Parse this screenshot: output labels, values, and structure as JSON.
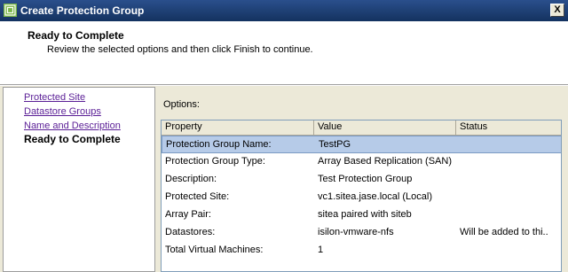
{
  "window": {
    "title": "Create Protection Group",
    "close_label": "X"
  },
  "header": {
    "title": "Ready to Complete",
    "subtitle": "Review the selected options and then click Finish to continue."
  },
  "nav": {
    "items": [
      {
        "label": "Protected Site"
      },
      {
        "label": "Datastore Groups"
      },
      {
        "label": "Name and Description"
      },
      {
        "label": "Ready to Complete"
      }
    ]
  },
  "options": {
    "label": "Options:",
    "columns": [
      "Property",
      "Value",
      "Status"
    ],
    "rows": [
      {
        "property": "Protection Group Name:",
        "value": "TestPG",
        "status": ""
      },
      {
        "property": "Protection Group Type:",
        "value": "Array Based Replication (SAN)",
        "status": ""
      },
      {
        "property": "Description:",
        "value": "Test Protection Group",
        "status": ""
      },
      {
        "property": "Protected Site:",
        "value": "vc1.sitea.jase.local (Local)",
        "status": ""
      },
      {
        "property": "Array Pair:",
        "value": "sitea paired with siteb",
        "status": ""
      },
      {
        "property": "Datastores:",
        "value": "isilon-vmware-nfs",
        "status": "Will be added to thi.."
      },
      {
        "property": "Total Virtual Machines:",
        "value": "1",
        "status": ""
      }
    ]
  },
  "colors": {
    "titlebar": "#1e3f75",
    "selection": "#b6cbe8",
    "visited_link": "#5a1e96"
  }
}
